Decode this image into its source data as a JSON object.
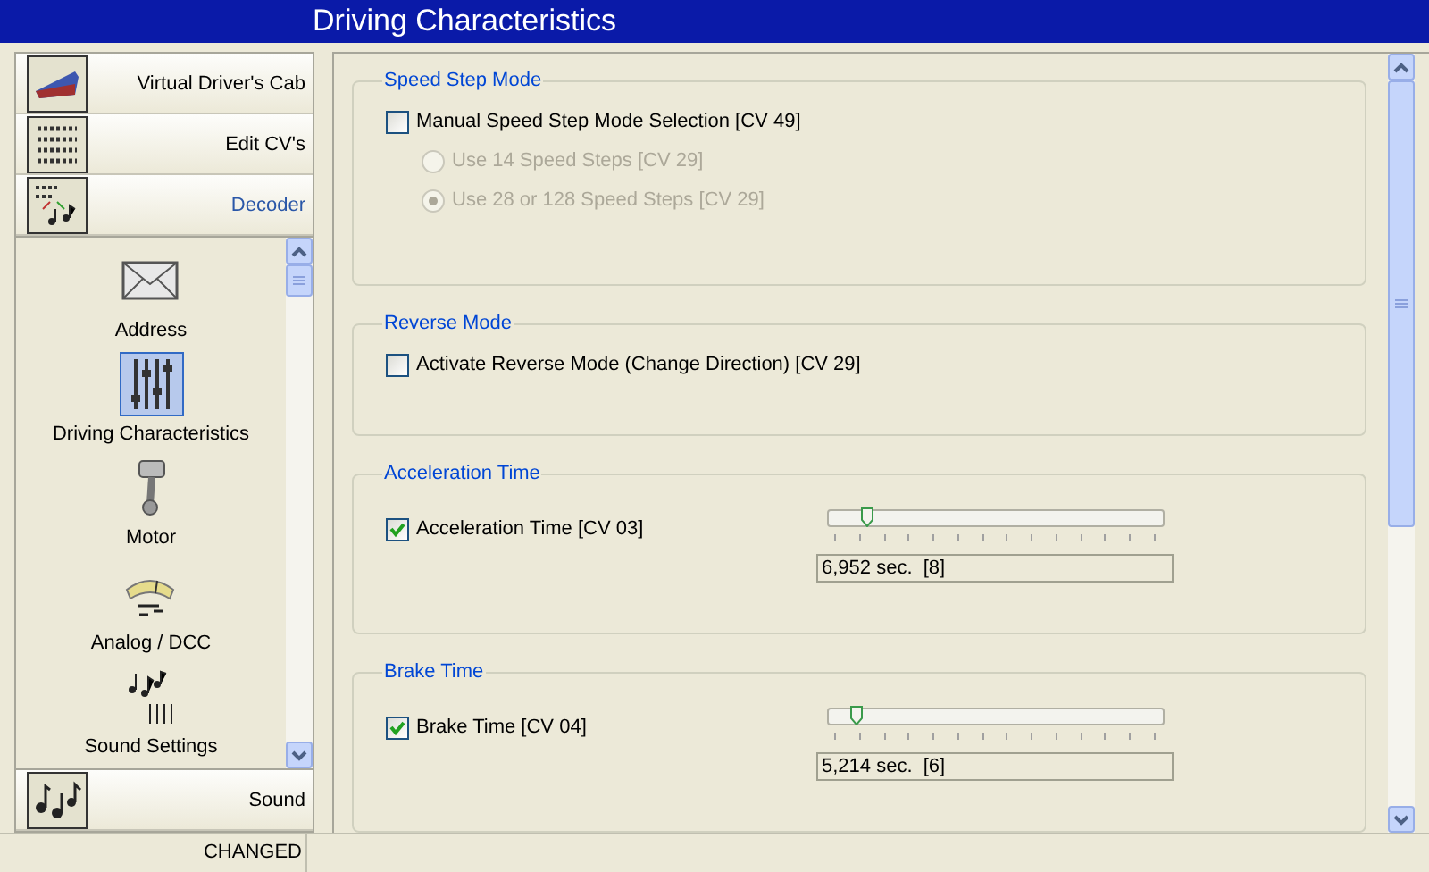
{
  "window": {
    "title": "Driving Characteristics"
  },
  "sidebar": {
    "sections": [
      {
        "label": "Virtual Driver's Cab",
        "selected": false
      },
      {
        "label": "Edit CV's",
        "selected": false
      },
      {
        "label": "Decoder",
        "selected": true
      }
    ],
    "items": [
      {
        "label": "Address",
        "selected": false
      },
      {
        "label": "Driving Characteristics",
        "selected": true
      },
      {
        "label": "Motor",
        "selected": false
      },
      {
        "label": "Analog / DCC",
        "selected": false
      },
      {
        "label": "Sound Settings",
        "selected": false
      }
    ],
    "footer_section": {
      "label": "Sound",
      "selected": false
    }
  },
  "groups": [
    {
      "title": "Speed Step Mode",
      "controls": [
        {
          "kind": "checkbox",
          "label": "Manual Speed Step Mode Selection [CV 49]",
          "checked": false,
          "disabled": false
        },
        {
          "kind": "radio",
          "label": "Use 14 Speed Steps [CV 29]",
          "selected": false,
          "disabled": true
        },
        {
          "kind": "radio",
          "label": "Use 28 or 128 Speed Steps [CV 29]",
          "selected": true,
          "disabled": true
        }
      ]
    },
    {
      "title": "Reverse Mode",
      "controls": [
        {
          "kind": "checkbox",
          "label": "Activate Reverse Mode (Change Direction) [CV 29]",
          "checked": false,
          "disabled": false
        }
      ]
    },
    {
      "title": "Acceleration Time",
      "controls": [
        {
          "kind": "slider",
          "label": "Acceleration Time [CV 03]",
          "checked": true,
          "level": 0.12,
          "reading": "6,952 sec.  [8]"
        }
      ]
    },
    {
      "title": "Brake Time",
      "controls": [
        {
          "kind": "slider",
          "label": "Brake Time [CV 04]",
          "checked": true,
          "level": 0.09,
          "reading": "5,214 sec.  [6]"
        }
      ]
    }
  ],
  "status_bar": {
    "text": "CHANGED"
  }
}
